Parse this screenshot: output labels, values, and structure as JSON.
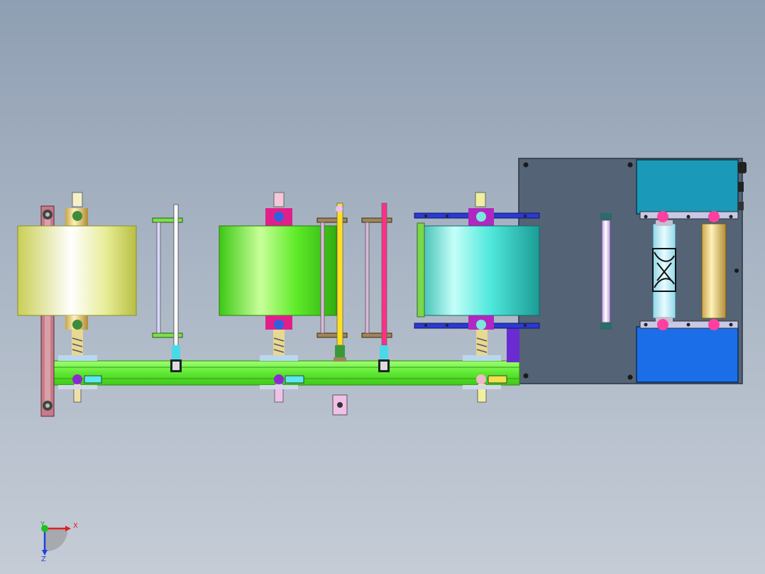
{
  "window": {
    "kind": "cad-3d-viewport"
  },
  "colors": {
    "background_top": "#8f9fb3",
    "background_bottom": "#c5ccd6",
    "frame_green": "#62f23a",
    "roll_yellow": "#e0e78a",
    "roll_green": "#5de82a",
    "roll_cyan": "#3fe3d8",
    "panel_gray": "#546376",
    "box_teal": "#1a9ab8",
    "box_blue": "#1b6ee8",
    "magenta": "#ff3fa0"
  },
  "triad": {
    "x_label": "X",
    "y_label": "Y",
    "z_label": "Z"
  }
}
